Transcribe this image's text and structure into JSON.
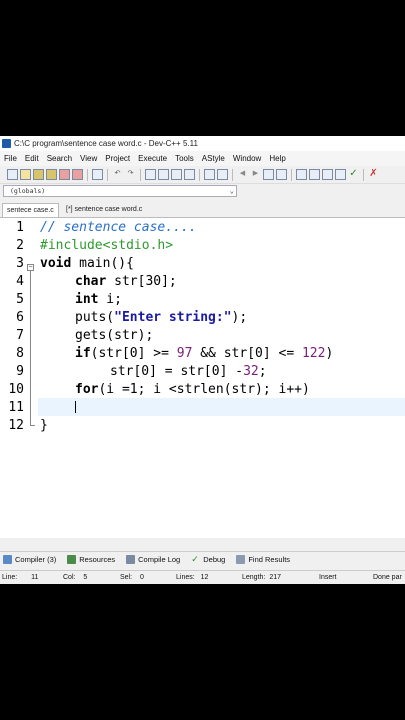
{
  "window": {
    "title": "C:\\C program\\sentence case word.c - Dev-C++ 5.11"
  },
  "menu": [
    "File",
    "Edit",
    "Search",
    "View",
    "Project",
    "Execute",
    "Tools",
    "AStyle",
    "Window",
    "Help"
  ],
  "scope": {
    "value": "(globals)"
  },
  "tabs": [
    {
      "label": "sentece case.c"
    },
    {
      "label": "[*] sentence case word.c"
    }
  ],
  "editor": {
    "line_numbers": [
      "1",
      "2",
      "3",
      "4",
      "5",
      "6",
      "7",
      "8",
      "9",
      "10",
      "11",
      "12"
    ],
    "lines": {
      "l1": "// sentence case....",
      "l2": "#include<stdio.h>",
      "l3a": "void",
      "l3b": " main(){",
      "l4a": "char",
      "l4b": " str[30];",
      "l5a": "int",
      "l5b": " i;",
      "l6a": "puts(",
      "l6b": "\"Enter string:\"",
      "l6c": ");",
      "l7": "gets(str);",
      "l8a": "if",
      "l8b": "(str[0] >= ",
      "l8c": "97",
      "l8d": " && str[0] <= ",
      "l8e": "122",
      "l8f": ")",
      "l9a": "str[0] = str[0] -",
      "l9b": "32",
      "l9c": ";",
      "l10a": "for",
      "l10b": "(i =1; i <strlen(str); i++)",
      "l12": "}"
    },
    "current_line": 11
  },
  "bottom_tabs": [
    {
      "label": "Compiler (3)",
      "icon": "compiler-icon"
    },
    {
      "label": "Resources",
      "icon": "resources-icon"
    },
    {
      "label": "Compile Log",
      "icon": "compile-log-icon"
    },
    {
      "label": "Debug",
      "icon": "debug-icon"
    },
    {
      "label": "Find Results",
      "icon": "find-results-icon"
    }
  ],
  "status": {
    "line_label": "Line:",
    "line": "11",
    "col_label": "Col:",
    "col": "5",
    "sel_label": "Sel:",
    "sel": "0",
    "lines_label": "Lines:",
    "lines": "12",
    "length_label": "Length:",
    "length": "217",
    "mode": "Insert",
    "message": "Done par"
  },
  "colors": {
    "comment": "#2a6fc9",
    "preprocessor": "#2e9a2e",
    "string": "#1a1aa6",
    "number": "#7a1e7a",
    "current_line": "#e9f4ff"
  }
}
